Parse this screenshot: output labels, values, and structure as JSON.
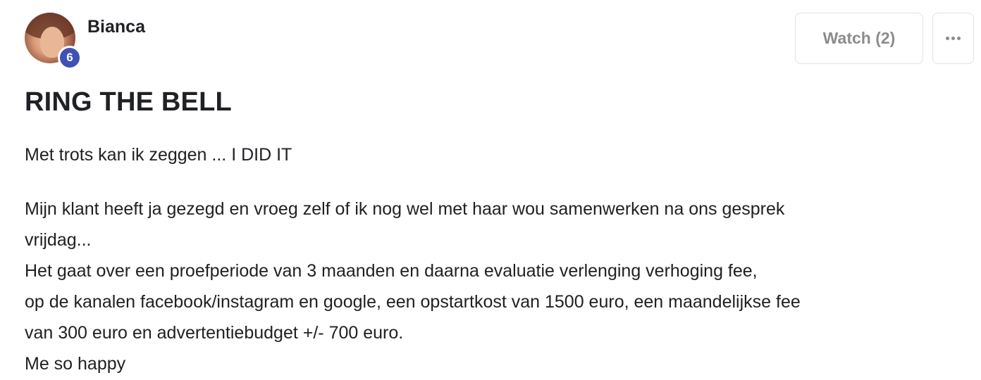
{
  "author": {
    "name": "Bianca",
    "level": "6"
  },
  "actions": {
    "watch_label": "Watch (2)",
    "more_icon": "ellipsis-icon"
  },
  "post": {
    "title": "RING THE BELL",
    "paragraphs": [
      "Met trots kan ik zeggen ... I DID IT",
      "Mijn klant heeft ja gezegd en vroeg zelf of ik nog wel met haar wou samenwerken na ons gesprek",
      "vrijdag...",
      "Het gaat over een proefperiode van 3 maanden en daarna evaluatie verlenging verhoging fee,",
      "op de kanalen facebook/instagram en google, een opstartkost van 1500 euro, een maandelijkse fee",
      "van 300 euro en advertentiebudget +/- 700 euro.",
      "Me so happy"
    ]
  },
  "colors": {
    "badge": "#3f51b5",
    "button_border": "#e2e2e2",
    "button_text": "#8c8c8c",
    "text": "#202124"
  }
}
